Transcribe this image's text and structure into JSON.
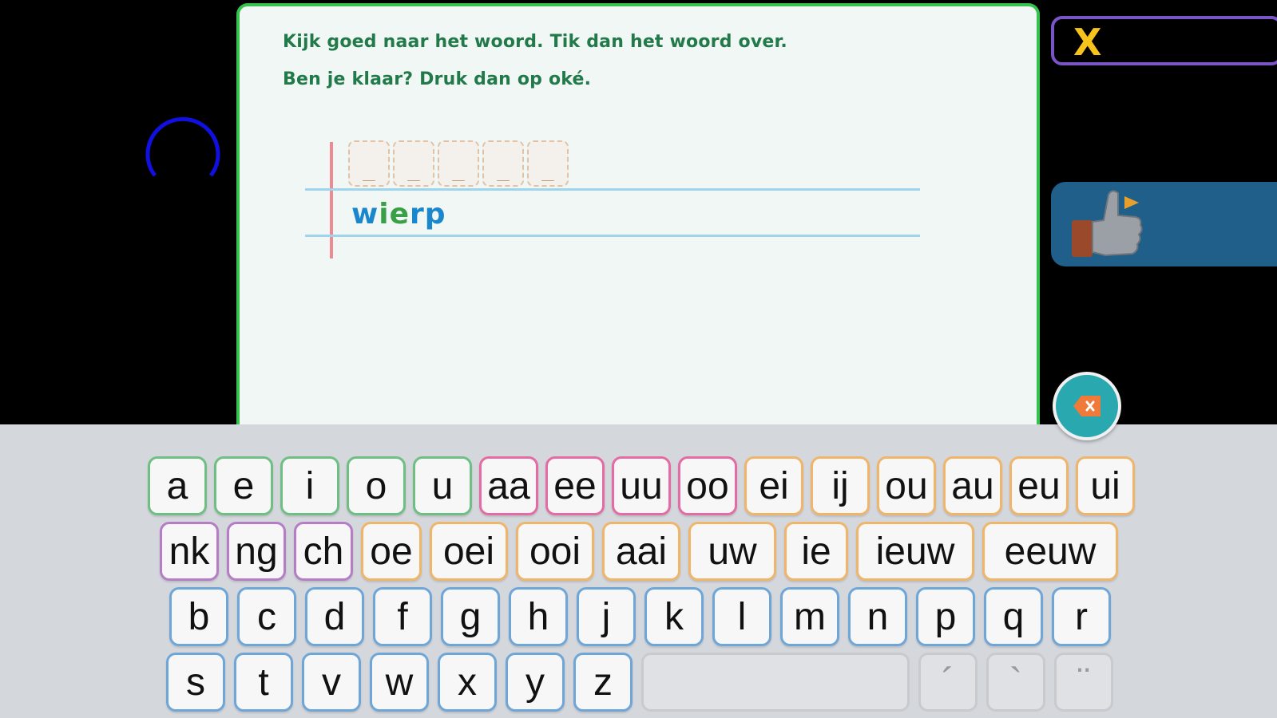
{
  "instructions": {
    "line1": "Kijk goed naar het woord. Tik dan het woord over.",
    "line2": "Ben je klaar? Druk dan op oké."
  },
  "answer_slots": [
    "_",
    "_",
    "_",
    "_",
    "_"
  ],
  "word": {
    "letters": [
      {
        "text": "w",
        "color": "#1a86cc"
      },
      {
        "text": "ie",
        "color": "#3aa048"
      },
      {
        "text": "r",
        "color": "#1a86cc"
      },
      {
        "text": "p",
        "color": "#1a86cc"
      }
    ]
  },
  "buttons": {
    "close_label": "X",
    "ok_icon": "thumbs-up-icon",
    "backspace_icon": "backspace-icon"
  },
  "keyboard": {
    "rows": [
      [
        {
          "label": "a",
          "group": "green"
        },
        {
          "label": "e",
          "group": "green"
        },
        {
          "label": "i",
          "group": "green"
        },
        {
          "label": "o",
          "group": "green"
        },
        {
          "label": "u",
          "group": "green"
        },
        {
          "label": "aa",
          "group": "pink"
        },
        {
          "label": "ee",
          "group": "pink"
        },
        {
          "label": "uu",
          "group": "pink"
        },
        {
          "label": "oo",
          "group": "pink"
        },
        {
          "label": "ei",
          "group": "orange"
        },
        {
          "label": "ij",
          "group": "orange"
        },
        {
          "label": "ou",
          "group": "orange"
        },
        {
          "label": "au",
          "group": "orange"
        },
        {
          "label": "eu",
          "group": "orange"
        },
        {
          "label": "ui",
          "group": "orange"
        }
      ],
      [
        {
          "label": "nk",
          "group": "purple"
        },
        {
          "label": "ng",
          "group": "purple"
        },
        {
          "label": "ch",
          "group": "purple"
        },
        {
          "label": "oe",
          "group": "orange"
        },
        {
          "label": "oei",
          "group": "orange"
        },
        {
          "label": "ooi",
          "group": "orange"
        },
        {
          "label": "aai",
          "group": "orange"
        },
        {
          "label": "uw",
          "group": "orange"
        },
        {
          "label": "ie",
          "group": "orange"
        },
        {
          "label": "ieuw",
          "group": "orange"
        },
        {
          "label": "eeuw",
          "group": "orange"
        }
      ],
      [
        {
          "label": "b",
          "group": "blue"
        },
        {
          "label": "c",
          "group": "blue"
        },
        {
          "label": "d",
          "group": "blue"
        },
        {
          "label": "f",
          "group": "blue"
        },
        {
          "label": "g",
          "group": "blue"
        },
        {
          "label": "h",
          "group": "blue"
        },
        {
          "label": "j",
          "group": "blue"
        },
        {
          "label": "k",
          "group": "blue"
        },
        {
          "label": "l",
          "group": "blue"
        },
        {
          "label": "m",
          "group": "blue"
        },
        {
          "label": "n",
          "group": "blue"
        },
        {
          "label": "p",
          "group": "blue"
        },
        {
          "label": "q",
          "group": "blue"
        },
        {
          "label": "r",
          "group": "blue"
        }
      ],
      [
        {
          "label": "s",
          "group": "blue"
        },
        {
          "label": "t",
          "group": "blue"
        },
        {
          "label": "v",
          "group": "blue"
        },
        {
          "label": "w",
          "group": "blue"
        },
        {
          "label": "x",
          "group": "blue"
        },
        {
          "label": "y",
          "group": "blue"
        },
        {
          "label": "z",
          "group": "blue"
        },
        {
          "label": "",
          "group": "disabled",
          "name": "space"
        },
        {
          "label": "´",
          "group": "disabled",
          "name": "acute"
        },
        {
          "label": "`",
          "group": "disabled",
          "name": "grave"
        },
        {
          "label": "¨",
          "group": "disabled",
          "name": "diaeresis"
        }
      ]
    ]
  },
  "colors": {
    "card_border": "#35c24d",
    "instruction_text": "#227a4a",
    "close_border": "#7b55c8",
    "close_x": "#f6c31d",
    "ok_bg": "#1f5f8a",
    "backspace_bg": "#29a8b0",
    "spinner": "#1010e0"
  }
}
